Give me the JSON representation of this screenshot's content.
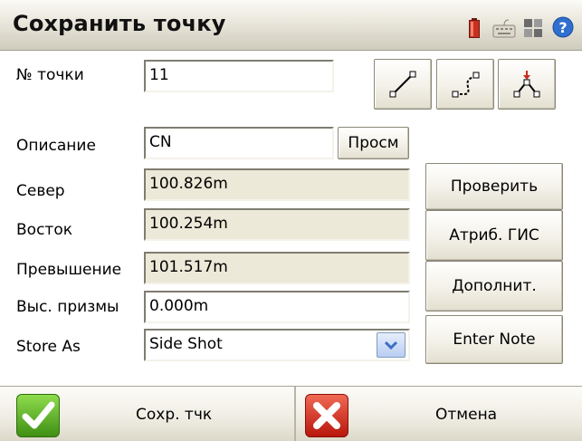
{
  "window": {
    "title": "Сохранить точку"
  },
  "tray": {
    "icons": [
      "battery-icon",
      "keyboard-icon",
      "grid-icon",
      "help-icon"
    ]
  },
  "form": {
    "point_no": {
      "label": "№ точки",
      "value": "11"
    },
    "description": {
      "label": "Описание",
      "value": "CN",
      "browse_label": "Просм"
    },
    "north": {
      "label": "Север",
      "value": "100.826m"
    },
    "east": {
      "label": "Восток",
      "value": "100.254m"
    },
    "elevation": {
      "label": "Превышение",
      "value": "101.517m"
    },
    "prism_height": {
      "label": "Выс. призмы",
      "value": "0.000m"
    },
    "store_as": {
      "label": "Store As",
      "value": "Side Shot"
    }
  },
  "toolbar": {
    "icons": [
      "line-icon",
      "polyline-icon",
      "node-icon"
    ]
  },
  "side_buttons": {
    "check": "Проверить",
    "gis_attr": "Атриб. ГИС",
    "more": "Дополнит.",
    "enter_note": "Enter Note"
  },
  "bottom": {
    "save_label": "Сохр. тчк",
    "cancel_label": "Отмена"
  },
  "colors": {
    "ok_green": "#4fa21f",
    "cancel_red": "#d42a1e",
    "dropdown_blue": "#3d6fc4"
  }
}
